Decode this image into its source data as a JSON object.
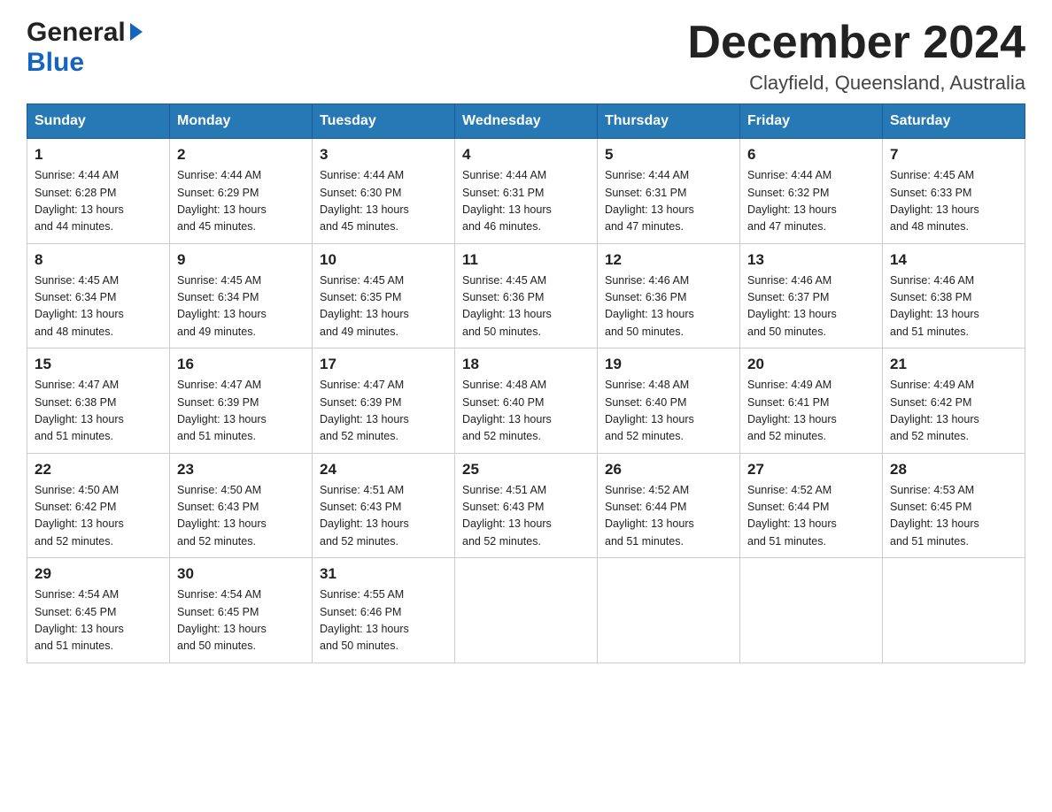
{
  "header": {
    "logo_general": "General",
    "logo_blue": "Blue",
    "month_title": "December 2024",
    "location": "Clayfield, Queensland, Australia"
  },
  "days_of_week": [
    "Sunday",
    "Monday",
    "Tuesday",
    "Wednesday",
    "Thursday",
    "Friday",
    "Saturday"
  ],
  "weeks": [
    [
      {
        "day": "1",
        "sunrise": "Sunrise: 4:44 AM",
        "sunset": "Sunset: 6:28 PM",
        "daylight": "Daylight: 13 hours",
        "daylight2": "and 44 minutes."
      },
      {
        "day": "2",
        "sunrise": "Sunrise: 4:44 AM",
        "sunset": "Sunset: 6:29 PM",
        "daylight": "Daylight: 13 hours",
        "daylight2": "and 45 minutes."
      },
      {
        "day": "3",
        "sunrise": "Sunrise: 4:44 AM",
        "sunset": "Sunset: 6:30 PM",
        "daylight": "Daylight: 13 hours",
        "daylight2": "and 45 minutes."
      },
      {
        "day": "4",
        "sunrise": "Sunrise: 4:44 AM",
        "sunset": "Sunset: 6:31 PM",
        "daylight": "Daylight: 13 hours",
        "daylight2": "and 46 minutes."
      },
      {
        "day": "5",
        "sunrise": "Sunrise: 4:44 AM",
        "sunset": "Sunset: 6:31 PM",
        "daylight": "Daylight: 13 hours",
        "daylight2": "and 47 minutes."
      },
      {
        "day": "6",
        "sunrise": "Sunrise: 4:44 AM",
        "sunset": "Sunset: 6:32 PM",
        "daylight": "Daylight: 13 hours",
        "daylight2": "and 47 minutes."
      },
      {
        "day": "7",
        "sunrise": "Sunrise: 4:45 AM",
        "sunset": "Sunset: 6:33 PM",
        "daylight": "Daylight: 13 hours",
        "daylight2": "and 48 minutes."
      }
    ],
    [
      {
        "day": "8",
        "sunrise": "Sunrise: 4:45 AM",
        "sunset": "Sunset: 6:34 PM",
        "daylight": "Daylight: 13 hours",
        "daylight2": "and 48 minutes."
      },
      {
        "day": "9",
        "sunrise": "Sunrise: 4:45 AM",
        "sunset": "Sunset: 6:34 PM",
        "daylight": "Daylight: 13 hours",
        "daylight2": "and 49 minutes."
      },
      {
        "day": "10",
        "sunrise": "Sunrise: 4:45 AM",
        "sunset": "Sunset: 6:35 PM",
        "daylight": "Daylight: 13 hours",
        "daylight2": "and 49 minutes."
      },
      {
        "day": "11",
        "sunrise": "Sunrise: 4:45 AM",
        "sunset": "Sunset: 6:36 PM",
        "daylight": "Daylight: 13 hours",
        "daylight2": "and 50 minutes."
      },
      {
        "day": "12",
        "sunrise": "Sunrise: 4:46 AM",
        "sunset": "Sunset: 6:36 PM",
        "daylight": "Daylight: 13 hours",
        "daylight2": "and 50 minutes."
      },
      {
        "day": "13",
        "sunrise": "Sunrise: 4:46 AM",
        "sunset": "Sunset: 6:37 PM",
        "daylight": "Daylight: 13 hours",
        "daylight2": "and 50 minutes."
      },
      {
        "day": "14",
        "sunrise": "Sunrise: 4:46 AM",
        "sunset": "Sunset: 6:38 PM",
        "daylight": "Daylight: 13 hours",
        "daylight2": "and 51 minutes."
      }
    ],
    [
      {
        "day": "15",
        "sunrise": "Sunrise: 4:47 AM",
        "sunset": "Sunset: 6:38 PM",
        "daylight": "Daylight: 13 hours",
        "daylight2": "and 51 minutes."
      },
      {
        "day": "16",
        "sunrise": "Sunrise: 4:47 AM",
        "sunset": "Sunset: 6:39 PM",
        "daylight": "Daylight: 13 hours",
        "daylight2": "and 51 minutes."
      },
      {
        "day": "17",
        "sunrise": "Sunrise: 4:47 AM",
        "sunset": "Sunset: 6:39 PM",
        "daylight": "Daylight: 13 hours",
        "daylight2": "and 52 minutes."
      },
      {
        "day": "18",
        "sunrise": "Sunrise: 4:48 AM",
        "sunset": "Sunset: 6:40 PM",
        "daylight": "Daylight: 13 hours",
        "daylight2": "and 52 minutes."
      },
      {
        "day": "19",
        "sunrise": "Sunrise: 4:48 AM",
        "sunset": "Sunset: 6:40 PM",
        "daylight": "Daylight: 13 hours",
        "daylight2": "and 52 minutes."
      },
      {
        "day": "20",
        "sunrise": "Sunrise: 4:49 AM",
        "sunset": "Sunset: 6:41 PM",
        "daylight": "Daylight: 13 hours",
        "daylight2": "and 52 minutes."
      },
      {
        "day": "21",
        "sunrise": "Sunrise: 4:49 AM",
        "sunset": "Sunset: 6:42 PM",
        "daylight": "Daylight: 13 hours",
        "daylight2": "and 52 minutes."
      }
    ],
    [
      {
        "day": "22",
        "sunrise": "Sunrise: 4:50 AM",
        "sunset": "Sunset: 6:42 PM",
        "daylight": "Daylight: 13 hours",
        "daylight2": "and 52 minutes."
      },
      {
        "day": "23",
        "sunrise": "Sunrise: 4:50 AM",
        "sunset": "Sunset: 6:43 PM",
        "daylight": "Daylight: 13 hours",
        "daylight2": "and 52 minutes."
      },
      {
        "day": "24",
        "sunrise": "Sunrise: 4:51 AM",
        "sunset": "Sunset: 6:43 PM",
        "daylight": "Daylight: 13 hours",
        "daylight2": "and 52 minutes."
      },
      {
        "day": "25",
        "sunrise": "Sunrise: 4:51 AM",
        "sunset": "Sunset: 6:43 PM",
        "daylight": "Daylight: 13 hours",
        "daylight2": "and 52 minutes."
      },
      {
        "day": "26",
        "sunrise": "Sunrise: 4:52 AM",
        "sunset": "Sunset: 6:44 PM",
        "daylight": "Daylight: 13 hours",
        "daylight2": "and 51 minutes."
      },
      {
        "day": "27",
        "sunrise": "Sunrise: 4:52 AM",
        "sunset": "Sunset: 6:44 PM",
        "daylight": "Daylight: 13 hours",
        "daylight2": "and 51 minutes."
      },
      {
        "day": "28",
        "sunrise": "Sunrise: 4:53 AM",
        "sunset": "Sunset: 6:45 PM",
        "daylight": "Daylight: 13 hours",
        "daylight2": "and 51 minutes."
      }
    ],
    [
      {
        "day": "29",
        "sunrise": "Sunrise: 4:54 AM",
        "sunset": "Sunset: 6:45 PM",
        "daylight": "Daylight: 13 hours",
        "daylight2": "and 51 minutes."
      },
      {
        "day": "30",
        "sunrise": "Sunrise: 4:54 AM",
        "sunset": "Sunset: 6:45 PM",
        "daylight": "Daylight: 13 hours",
        "daylight2": "and 50 minutes."
      },
      {
        "day": "31",
        "sunrise": "Sunrise: 4:55 AM",
        "sunset": "Sunset: 6:46 PM",
        "daylight": "Daylight: 13 hours",
        "daylight2": "and 50 minutes."
      },
      null,
      null,
      null,
      null
    ]
  ]
}
